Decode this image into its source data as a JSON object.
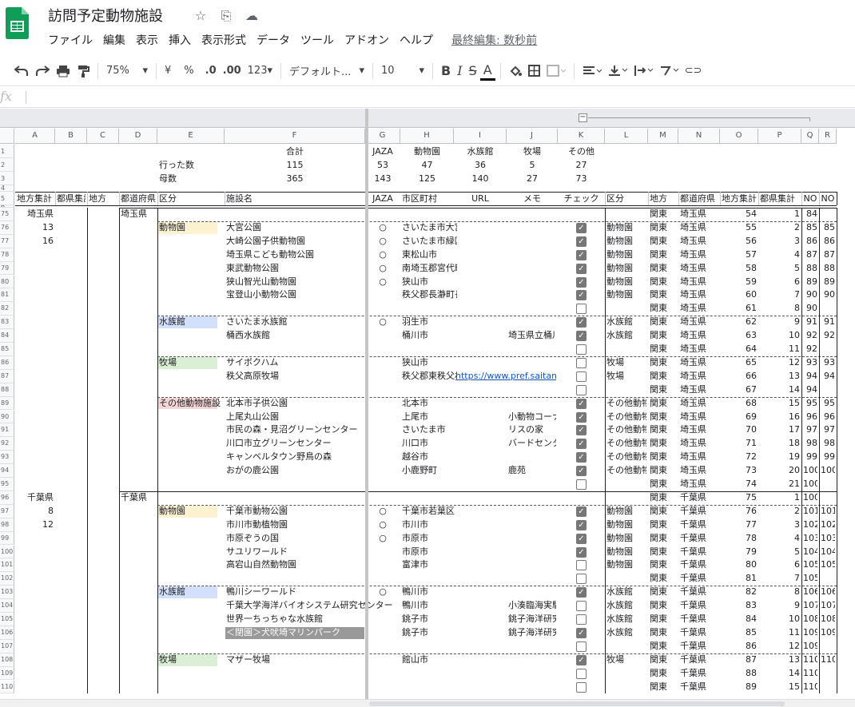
{
  "doc": {
    "title": "訪問予定動物施設"
  },
  "menu": [
    "ファイル",
    "編集",
    "表示",
    "挿入",
    "表示形式",
    "データ",
    "ツール",
    "アドオン",
    "ヘルプ"
  ],
  "last_edit": "最終編集: 数秒前",
  "toolbar": {
    "zoom": "75%",
    "currency": "¥",
    "percent": "%",
    "dec_less": ".0",
    "dec_more": ".00",
    "format": "123",
    "font": "デフォルト...",
    "size": "10",
    "bold": "B",
    "italic": "I",
    "strike": "S",
    "textcolor": "A"
  },
  "formula": {
    "fx": "fx",
    "value": ""
  },
  "colors": {
    "zoo": "#fdf2d0",
    "aqua": "#d2e0fb",
    "farm": "#dbeed6",
    "other": "#f4d6d6",
    "check": "#777777"
  },
  "columns": [
    {
      "letter": "A",
      "w": 50
    },
    {
      "letter": "B",
      "w": 40
    },
    {
      "letter": "C",
      "w": 40
    },
    {
      "letter": "D",
      "w": 48
    },
    {
      "letter": "E",
      "w": 84
    },
    {
      "letter": "F",
      "w": 176
    },
    {
      "letter": "G",
      "w": 44
    },
    {
      "letter": "H",
      "w": 67
    },
    {
      "letter": "I",
      "w": 66
    },
    {
      "letter": "J",
      "w": 64
    },
    {
      "letter": "K",
      "w": 59
    },
    {
      "letter": "L",
      "w": 54
    },
    {
      "letter": "M",
      "w": 38
    },
    {
      "letter": "N",
      "w": 52
    },
    {
      "letter": "O",
      "w": 48
    },
    {
      "letter": "P",
      "w": 54
    },
    {
      "letter": "Q",
      "w": 22
    },
    {
      "letter": "R",
      "w": 22
    }
  ],
  "summary": {
    "top": {
      "F": "合計",
      "G": "JAZA",
      "H": "動物園",
      "I": "水族館",
      "J": "牧場",
      "K": "その他"
    },
    "visited": {
      "E": "行った数",
      "F": "115",
      "G": "53",
      "H": "47",
      "I": "36",
      "J": "5",
      "K": "27"
    },
    "total": {
      "E": "母数",
      "F": "365",
      "G": "143",
      "H": "125",
      "I": "140",
      "J": "27",
      "K": "73"
    }
  },
  "header": {
    "A": "地方集計",
    "B": "都県集計",
    "C": "地方",
    "D": "都道府県",
    "E": "区分",
    "F": "施設名",
    "G": "JAZA",
    "H": "市区町村",
    "I": "URL",
    "J": "メモ",
    "K": "チェック",
    "L": "区分",
    "M": "地方",
    "N": "都道府県",
    "O": "地方集計",
    "P": "都県集計",
    "Q": "NO",
    "R": "NO"
  },
  "row_numbers": [
    "1",
    "2",
    "3",
    "4",
    "5",
    "6",
    "75",
    "76",
    "77",
    "78",
    "79",
    "80",
    "81",
    "82",
    "83",
    "84",
    "85",
    "86",
    "87",
    "88",
    "89",
    "90",
    "91",
    "92",
    "93",
    "94",
    "95",
    "96",
    "97",
    "98",
    "99",
    "100",
    "101",
    "102",
    "103",
    "104",
    "105",
    "106",
    "107",
    "108",
    "109",
    "110"
  ],
  "rows": [
    {
      "A": "埼玉県",
      "D": "埼玉県",
      "M": "関東",
      "N": "埼玉県",
      "O": "54",
      "P": "1",
      "Q": "84"
    },
    {
      "A": "13",
      "E": "動物園",
      "cat": "zoo",
      "F": "大宮公園",
      "G": "○",
      "H": "さいたま市大宮区",
      "K": true,
      "L": "動物園",
      "M": "関東",
      "N": "埼玉県",
      "O": "55",
      "P": "2",
      "Q": "85",
      "R": "85"
    },
    {
      "A": "16",
      "F": "大崎公園子供動物園",
      "G": "○",
      "H": "さいたま市緑区",
      "K": true,
      "L": "動物園",
      "M": "関東",
      "N": "埼玉県",
      "O": "56",
      "P": "3",
      "Q": "86",
      "R": "86"
    },
    {
      "F": "埼玉県こども動物公園",
      "G": "○",
      "H": "東松山市",
      "K": true,
      "L": "動物園",
      "M": "関東",
      "N": "埼玉県",
      "O": "57",
      "P": "4",
      "Q": "87",
      "R": "87"
    },
    {
      "F": "東武動物公園",
      "G": "○",
      "H": "南埼玉郡宮代町",
      "K": true,
      "L": "動物園",
      "M": "関東",
      "N": "埼玉県",
      "O": "58",
      "P": "5",
      "Q": "88",
      "R": "88"
    },
    {
      "F": "狭山智光山動物園",
      "G": "○",
      "H": "狭山市",
      "K": true,
      "L": "動物園",
      "M": "関東",
      "N": "埼玉県",
      "O": "59",
      "P": "6",
      "Q": "89",
      "R": "89"
    },
    {
      "F": "宝登山小動物公園",
      "H": "秩父郡長瀞町長瀞",
      "K": true,
      "L": "動物園",
      "M": "関東",
      "N": "埼玉県",
      "O": "60",
      "P": "7",
      "Q": "90",
      "R": "90"
    },
    {
      "K": false,
      "M": "関東",
      "N": "埼玉県",
      "O": "61",
      "P": "8",
      "Q": "90"
    },
    {
      "E": "水族館",
      "cat": "aqua",
      "F": "さいたま水族館",
      "G": "○",
      "H": "羽生市",
      "K": true,
      "L": "水族館",
      "M": "関東",
      "N": "埼玉県",
      "O": "62",
      "P": "9",
      "Q": "91",
      "R": "91"
    },
    {
      "F": "桶西水族館",
      "H": "桶川市",
      "J": "埼玉県立桶川",
      "K": true,
      "L": "水族館",
      "M": "関東",
      "N": "埼玉県",
      "O": "63",
      "P": "10",
      "Q": "92",
      "R": "92"
    },
    {
      "K": false,
      "M": "関東",
      "N": "埼玉県",
      "O": "64",
      "P": "11",
      "Q": "92"
    },
    {
      "E": "牧場",
      "cat": "farm",
      "F": "サイボクハム",
      "H": "狭山市",
      "K": false,
      "L": "牧場",
      "M": "関東",
      "N": "埼玉県",
      "O": "65",
      "P": "12",
      "Q": "93",
      "R": "93"
    },
    {
      "F": "秩父高原牧場",
      "H": "秩父郡東秩父村",
      "I": "https://www.pref.saitama",
      "K": false,
      "L": "牧場",
      "M": "関東",
      "N": "埼玉県",
      "O": "66",
      "P": "13",
      "Q": "94",
      "R": "94"
    },
    {
      "K": false,
      "M": "関東",
      "N": "埼玉県",
      "O": "67",
      "P": "14",
      "Q": "94"
    },
    {
      "E": "その他動物施設",
      "cat": "other",
      "F": "北本市子供公園",
      "H": "北本市",
      "K": true,
      "L": "その他動物",
      "M": "関東",
      "N": "埼玉県",
      "O": "68",
      "P": "15",
      "Q": "95",
      "R": "95"
    },
    {
      "F": "上尾丸山公園",
      "H": "上尾市",
      "J": "小動物コーナー",
      "K": true,
      "L": "その他動物",
      "M": "関東",
      "N": "埼玉県",
      "O": "69",
      "P": "16",
      "Q": "96",
      "R": "96"
    },
    {
      "F": "市民の森・見沼グリーンセンター",
      "H": "さいたま市",
      "J": "リスの家",
      "K": true,
      "L": "その他動物",
      "M": "関東",
      "N": "埼玉県",
      "O": "70",
      "P": "17",
      "Q": "97",
      "R": "97"
    },
    {
      "F": "川口市立グリーンセンター",
      "H": "川口市",
      "J": "バードセンター",
      "K": true,
      "L": "その他動物",
      "M": "関東",
      "N": "埼玉県",
      "O": "71",
      "P": "18",
      "Q": "98",
      "R": "98"
    },
    {
      "F": "キャンベルタウン野鳥の森",
      "H": "越谷市",
      "K": true,
      "L": "その他動物",
      "M": "関東",
      "N": "埼玉県",
      "O": "72",
      "P": "19",
      "Q": "99",
      "R": "99"
    },
    {
      "F": "おがの鹿公園",
      "H": "小鹿野町",
      "J": "鹿苑",
      "K": true,
      "L": "その他動物",
      "M": "関東",
      "N": "埼玉県",
      "O": "73",
      "P": "20",
      "Q": "100",
      "R": "100"
    },
    {
      "K": false,
      "M": "関東",
      "N": "埼玉県",
      "O": "74",
      "P": "21",
      "Q": "100"
    },
    {
      "A": "千葉県",
      "D": "千葉県",
      "M": "関東",
      "N": "千葉県",
      "O": "75",
      "P": "1",
      "Q": "100"
    },
    {
      "A": "8",
      "E": "動物園",
      "cat": "zoo",
      "F": "千葉市動物公園",
      "G": "○",
      "H": "千葉市若葉区",
      "K": true,
      "L": "動物園",
      "M": "関東",
      "N": "千葉県",
      "O": "76",
      "P": "2",
      "Q": "101",
      "R": "101"
    },
    {
      "A": "12",
      "F": "市川市動植物園",
      "G": "○",
      "H": "市川市",
      "K": true,
      "L": "動物園",
      "M": "関東",
      "N": "千葉県",
      "O": "77",
      "P": "3",
      "Q": "102",
      "R": "102"
    },
    {
      "F": "市原ぞうの国",
      "G": "○",
      "H": "市原市",
      "K": true,
      "L": "動物園",
      "M": "関東",
      "N": "千葉県",
      "O": "78",
      "P": "4",
      "Q": "103",
      "R": "103"
    },
    {
      "F": "サユリワールド",
      "H": "市原市",
      "K": true,
      "L": "動物園",
      "M": "関東",
      "N": "千葉県",
      "O": "79",
      "P": "5",
      "Q": "104",
      "R": "104"
    },
    {
      "F": "高宕山自然動物園",
      "H": "富津市",
      "K": false,
      "L": "動物園",
      "M": "関東",
      "N": "千葉県",
      "O": "80",
      "P": "6",
      "Q": "105",
      "R": "105"
    },
    {
      "K": false,
      "M": "関東",
      "N": "千葉県",
      "O": "81",
      "P": "7",
      "Q": "105"
    },
    {
      "E": "水族館",
      "cat": "aqua",
      "F": "鴨川シーワールド",
      "G": "○",
      "H": "鴨川市",
      "K": true,
      "L": "水族館",
      "M": "関東",
      "N": "千葉県",
      "O": "82",
      "P": "8",
      "Q": "106",
      "R": "106"
    },
    {
      "F": "千葉大学海洋バイオシステム研究センター",
      "H": "鴨川市",
      "J": "小湊臨海実験",
      "K": false,
      "L": "水族館",
      "M": "関東",
      "N": "千葉県",
      "O": "83",
      "P": "9",
      "Q": "107",
      "R": "107"
    },
    {
      "F": "世界一ちっちゃな水族館",
      "H": "銚子市",
      "J": "銚子海洋研究",
      "K": false,
      "L": "水族館",
      "M": "関東",
      "N": "千葉県",
      "O": "84",
      "P": "10",
      "Q": "108",
      "R": "108"
    },
    {
      "F": "＜閉園＞犬吠埼マリンパーク",
      "closed": true,
      "H": "銚子市",
      "J": "銚子海洋研究",
      "K": true,
      "L": "水族館",
      "M": "関東",
      "N": "千葉県",
      "O": "85",
      "P": "11",
      "Q": "109",
      "R": "109"
    },
    {
      "K": false,
      "M": "関東",
      "N": "千葉県",
      "O": "86",
      "P": "12",
      "Q": "109"
    },
    {
      "E": "牧場",
      "cat": "farm",
      "F": "マザー牧場",
      "H": "館山市",
      "K": true,
      "L": "牧場",
      "M": "関東",
      "N": "千葉県",
      "O": "87",
      "P": "13",
      "Q": "110",
      "R": "110"
    },
    {
      "K": false,
      "M": "関東",
      "N": "千葉県",
      "O": "88",
      "P": "14",
      "Q": "110"
    },
    {
      "K": false,
      "M": "関東",
      "N": "千葉県",
      "O": "89",
      "P": "15",
      "Q": "110"
    }
  ]
}
